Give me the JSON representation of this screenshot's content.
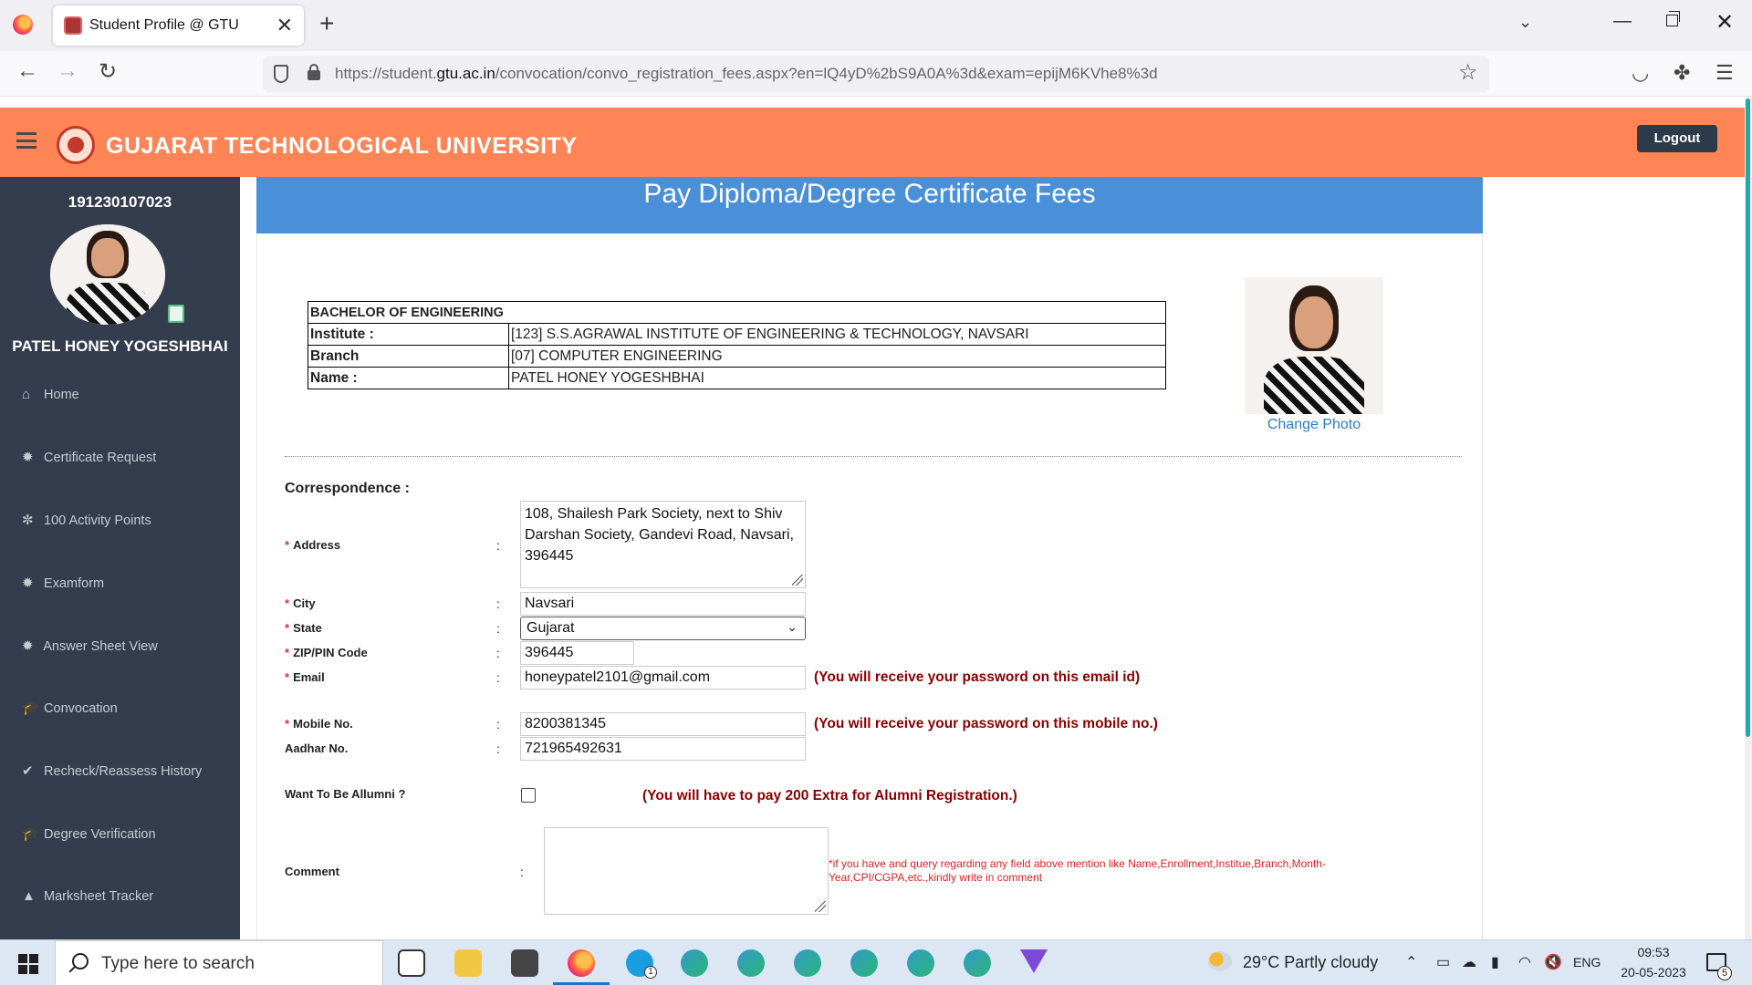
{
  "browser": {
    "tab_title": "Student Profile @ GTU",
    "url_prefix": "https://student.",
    "url_domain": "gtu.ac.in",
    "url_path": "/convocation/convo_registration_fees.aspx?en=lQ4yD%2bS9A0A%3d&exam=epijM6KVhe8%3d"
  },
  "header": {
    "site_title": "GUJARAT TECHNOLOGICAL UNIVERSITY",
    "logout_label": "Logout",
    "color": "#ff8556"
  },
  "sidebar": {
    "enrollment_no": "191230107023",
    "student_name": "PATEL HONEY YOGESHBHAI",
    "items": [
      {
        "label": "Home",
        "icon": "home-icon"
      },
      {
        "label": "Certificate Request",
        "icon": "gear-icon"
      },
      {
        "label": "100 Activity Points",
        "icon": "gears-icon"
      },
      {
        "label": "Examform",
        "icon": "gear-icon"
      },
      {
        "label": "Answer Sheet View",
        "icon": "gear-icon"
      },
      {
        "label": "Convocation",
        "icon": "graduation-cap-icon"
      },
      {
        "label": "Recheck/Reassess History",
        "icon": "check-icon"
      },
      {
        "label": "Degree Verification",
        "icon": "graduation-cap-icon"
      },
      {
        "label": "Marksheet Tracker",
        "icon": "road-icon"
      }
    ]
  },
  "page": {
    "title": "Pay Diploma/Degree Certificate Fees",
    "change_photo": "Change Photo",
    "info_table": {
      "degree": "BACHELOR OF ENGINEERING",
      "rows": [
        {
          "label": "Institute :",
          "value": "[123] S.S.AGRAWAL INSTITUTE OF ENGINEERING & TECHNOLOGY, NAVSARI"
        },
        {
          "label": "Branch",
          "value": "[07] COMPUTER ENGINEERING"
        },
        {
          "label": "Name :",
          "value": "PATEL HONEY YOGESHBHAI"
        }
      ]
    }
  },
  "form": {
    "heading": "Correspondence :",
    "colon": ":",
    "address_label": "Address",
    "address_value": "108, Shailesh Park Society, next to Shiv Darshan Society, Gandevi Road, Navsari, 396445",
    "city_label": "City",
    "city_value": "Navsari",
    "state_label": "State",
    "state_value": "Gujarat",
    "zip_label": "ZIP/PIN Code",
    "zip_value": "396445",
    "email_label": "Email",
    "email_value": "honeypatel2101@gmail.com",
    "email_note": "(You will receive your password on this email id)",
    "mobile_label": "Mobile No.",
    "mobile_value": "8200381345",
    "mobile_note": "(You will receive your password on this mobile no.)",
    "aadhar_label": "Aadhar No.",
    "aadhar_value": "721965492631",
    "alumni_label": "Want To Be Allumni ?",
    "alumni_note": "(You will have to pay 200 Extra for Alumni Registration.)",
    "comment_label": "Comment",
    "comment_note": "*if you have and query regarding any field above mention like Name,Enrollment,Institue,Branch,Month-Year,CPI/CGPA,etc.,kindly write in comment"
  },
  "taskbar": {
    "search_placeholder": "Type here to search",
    "weather": "29°C  Partly cloudy",
    "language": "ENG",
    "time": "09:53",
    "date": "20-05-2023",
    "notification_count": "5",
    "skype_badge": "1"
  }
}
